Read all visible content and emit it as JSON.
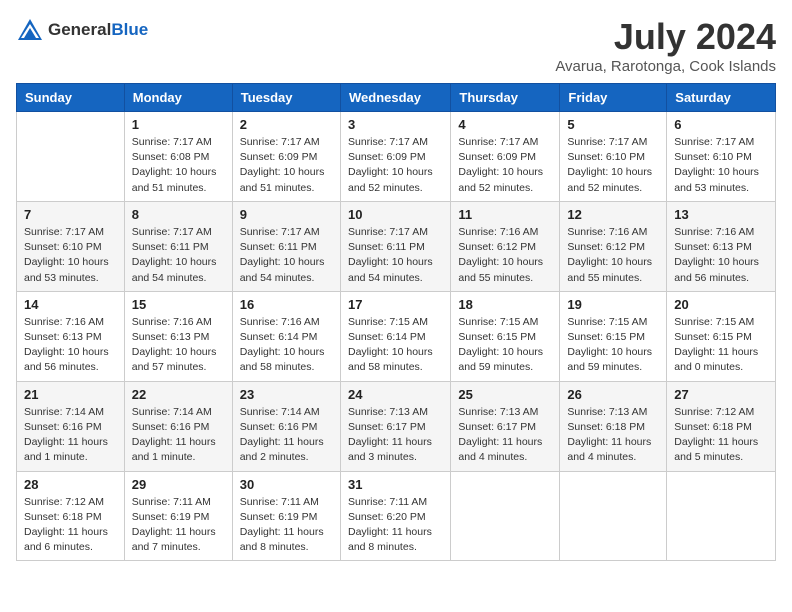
{
  "logo": {
    "general": "General",
    "blue": "Blue"
  },
  "title": "July 2024",
  "location": "Avarua, Rarotonga, Cook Islands",
  "days_of_week": [
    "Sunday",
    "Monday",
    "Tuesday",
    "Wednesday",
    "Thursday",
    "Friday",
    "Saturday"
  ],
  "weeks": [
    [
      {
        "day": "",
        "info": ""
      },
      {
        "day": "1",
        "info": "Sunrise: 7:17 AM\nSunset: 6:08 PM\nDaylight: 10 hours\nand 51 minutes."
      },
      {
        "day": "2",
        "info": "Sunrise: 7:17 AM\nSunset: 6:09 PM\nDaylight: 10 hours\nand 51 minutes."
      },
      {
        "day": "3",
        "info": "Sunrise: 7:17 AM\nSunset: 6:09 PM\nDaylight: 10 hours\nand 52 minutes."
      },
      {
        "day": "4",
        "info": "Sunrise: 7:17 AM\nSunset: 6:09 PM\nDaylight: 10 hours\nand 52 minutes."
      },
      {
        "day": "5",
        "info": "Sunrise: 7:17 AM\nSunset: 6:10 PM\nDaylight: 10 hours\nand 52 minutes."
      },
      {
        "day": "6",
        "info": "Sunrise: 7:17 AM\nSunset: 6:10 PM\nDaylight: 10 hours\nand 53 minutes."
      }
    ],
    [
      {
        "day": "7",
        "info": "Sunrise: 7:17 AM\nSunset: 6:10 PM\nDaylight: 10 hours\nand 53 minutes."
      },
      {
        "day": "8",
        "info": "Sunrise: 7:17 AM\nSunset: 6:11 PM\nDaylight: 10 hours\nand 54 minutes."
      },
      {
        "day": "9",
        "info": "Sunrise: 7:17 AM\nSunset: 6:11 PM\nDaylight: 10 hours\nand 54 minutes."
      },
      {
        "day": "10",
        "info": "Sunrise: 7:17 AM\nSunset: 6:11 PM\nDaylight: 10 hours\nand 54 minutes."
      },
      {
        "day": "11",
        "info": "Sunrise: 7:16 AM\nSunset: 6:12 PM\nDaylight: 10 hours\nand 55 minutes."
      },
      {
        "day": "12",
        "info": "Sunrise: 7:16 AM\nSunset: 6:12 PM\nDaylight: 10 hours\nand 55 minutes."
      },
      {
        "day": "13",
        "info": "Sunrise: 7:16 AM\nSunset: 6:13 PM\nDaylight: 10 hours\nand 56 minutes."
      }
    ],
    [
      {
        "day": "14",
        "info": "Sunrise: 7:16 AM\nSunset: 6:13 PM\nDaylight: 10 hours\nand 56 minutes."
      },
      {
        "day": "15",
        "info": "Sunrise: 7:16 AM\nSunset: 6:13 PM\nDaylight: 10 hours\nand 57 minutes."
      },
      {
        "day": "16",
        "info": "Sunrise: 7:16 AM\nSunset: 6:14 PM\nDaylight: 10 hours\nand 58 minutes."
      },
      {
        "day": "17",
        "info": "Sunrise: 7:15 AM\nSunset: 6:14 PM\nDaylight: 10 hours\nand 58 minutes."
      },
      {
        "day": "18",
        "info": "Sunrise: 7:15 AM\nSunset: 6:15 PM\nDaylight: 10 hours\nand 59 minutes."
      },
      {
        "day": "19",
        "info": "Sunrise: 7:15 AM\nSunset: 6:15 PM\nDaylight: 10 hours\nand 59 minutes."
      },
      {
        "day": "20",
        "info": "Sunrise: 7:15 AM\nSunset: 6:15 PM\nDaylight: 11 hours\nand 0 minutes."
      }
    ],
    [
      {
        "day": "21",
        "info": "Sunrise: 7:14 AM\nSunset: 6:16 PM\nDaylight: 11 hours\nand 1 minute."
      },
      {
        "day": "22",
        "info": "Sunrise: 7:14 AM\nSunset: 6:16 PM\nDaylight: 11 hours\nand 1 minute."
      },
      {
        "day": "23",
        "info": "Sunrise: 7:14 AM\nSunset: 6:16 PM\nDaylight: 11 hours\nand 2 minutes."
      },
      {
        "day": "24",
        "info": "Sunrise: 7:13 AM\nSunset: 6:17 PM\nDaylight: 11 hours\nand 3 minutes."
      },
      {
        "day": "25",
        "info": "Sunrise: 7:13 AM\nSunset: 6:17 PM\nDaylight: 11 hours\nand 4 minutes."
      },
      {
        "day": "26",
        "info": "Sunrise: 7:13 AM\nSunset: 6:18 PM\nDaylight: 11 hours\nand 4 minutes."
      },
      {
        "day": "27",
        "info": "Sunrise: 7:12 AM\nSunset: 6:18 PM\nDaylight: 11 hours\nand 5 minutes."
      }
    ],
    [
      {
        "day": "28",
        "info": "Sunrise: 7:12 AM\nSunset: 6:18 PM\nDaylight: 11 hours\nand 6 minutes."
      },
      {
        "day": "29",
        "info": "Sunrise: 7:11 AM\nSunset: 6:19 PM\nDaylight: 11 hours\nand 7 minutes."
      },
      {
        "day": "30",
        "info": "Sunrise: 7:11 AM\nSunset: 6:19 PM\nDaylight: 11 hours\nand 8 minutes."
      },
      {
        "day": "31",
        "info": "Sunrise: 7:11 AM\nSunset: 6:20 PM\nDaylight: 11 hours\nand 8 minutes."
      },
      {
        "day": "",
        "info": ""
      },
      {
        "day": "",
        "info": ""
      },
      {
        "day": "",
        "info": ""
      }
    ]
  ]
}
